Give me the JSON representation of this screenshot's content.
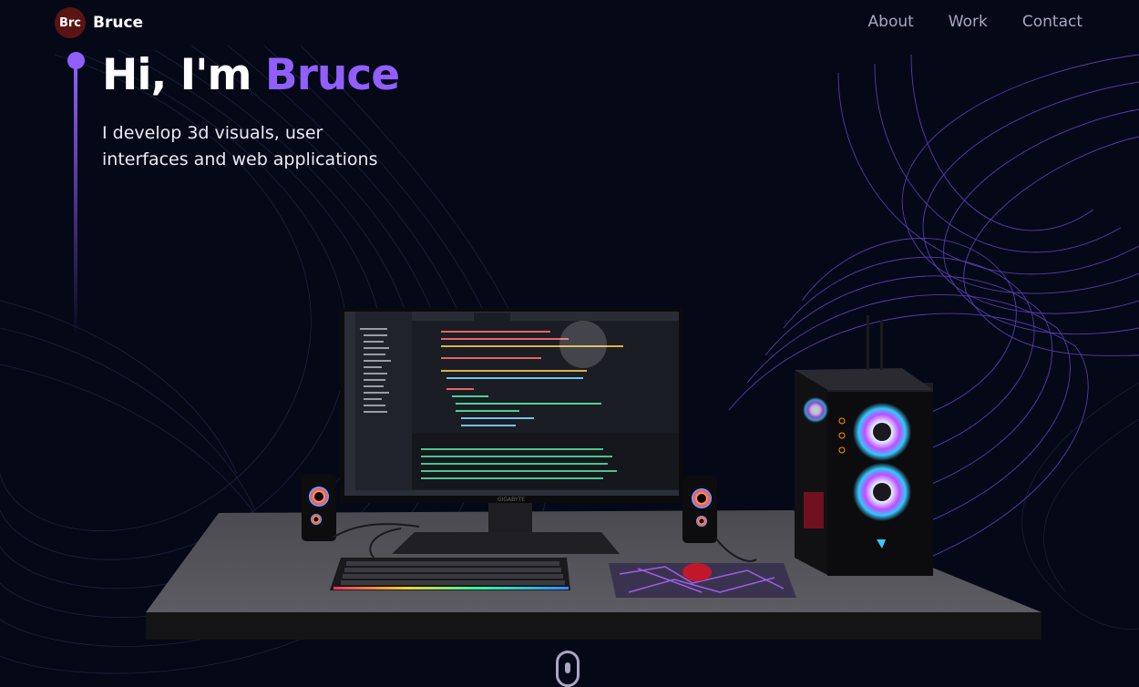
{
  "nav": {
    "logo_badge": "Brc",
    "logo_name": "Bruce",
    "links": [
      "About",
      "Work",
      "Contact"
    ]
  },
  "hero": {
    "greeting": "Hi, I'm",
    "name": "Bruce",
    "subtitle_line1": "I develop 3d visuals, user",
    "subtitle_line2": "interfaces and web applications"
  },
  "scene": {
    "monitor_brand": "GIGABYTE"
  },
  "colors": {
    "background": "#050816",
    "accent": "#915eff",
    "nav_text": "#aaa6c3",
    "logo_badge": "#5a1414"
  },
  "icons": [
    "scroll-mouse-icon"
  ]
}
